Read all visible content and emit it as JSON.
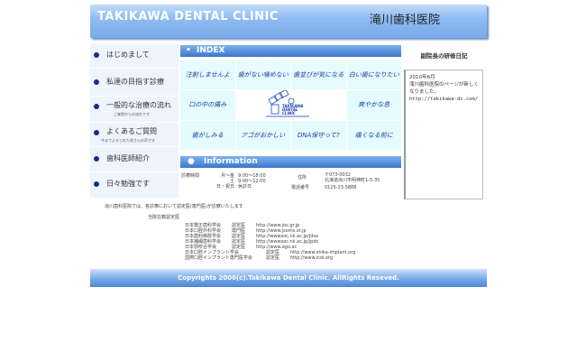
{
  "header": {
    "title_en": "TAKIKAWA DENTAL CLINIC",
    "title_jp": "滝川歯科医院"
  },
  "sidebar": {
    "items": [
      {
        "label": "はじめまして",
        "sub": ""
      },
      {
        "label": "私達の目指す診療",
        "sub": ""
      },
      {
        "label": "一般的な治療の流れ",
        "sub": "ご来院からの流れです"
      },
      {
        "label": "よくあるご質問",
        "sub": "今までよせられた皆さんの声です"
      },
      {
        "label": "歯科医師紹介",
        "sub": ""
      },
      {
        "label": "日々勉強です",
        "sub": ""
      }
    ]
  },
  "index": {
    "title": "INDEX",
    "cells": [
      "注射しませんよ",
      "歯がない噛めない",
      "歯並びが気になる",
      "白い歯になりたい",
      "口の中の痛み",
      "爽やかな息",
      "歯がしみる",
      "アゴがおかしい",
      "DNA保守って?",
      "痛くなる前に"
    ],
    "logo_text": "TAKIKAWA DENTAL CLINIC"
  },
  "information": {
    "title": "Information",
    "hours_label": "診療時間",
    "hours": [
      {
        "day": "月～金",
        "time": "9:00～18:00"
      },
      {
        "day": "土",
        "time": "9:00～12:00"
      },
      {
        "day": "日・祝日",
        "time": "休診日"
      }
    ],
    "address_label": "住所",
    "address": [
      "〒073-0032",
      "北海道滝川市明神町1-5-35"
    ],
    "phone_label": "電話番号",
    "phone": "0125-23-5888"
  },
  "diary": {
    "title": "副院長の研修日記",
    "lines": [
      "2010年6月",
      "滝川歯科医院のページが新しくなりました。",
      "http://takikawa-dc.com/"
    ]
  },
  "certification": {
    "intro": "滝川歯科医院では、各診療において認定医(専門医)が診療いたします",
    "sub": "当院在籍認定医",
    "rows": [
      [
        "日本矯正歯科学会",
        "認定医",
        "http://www.jos.gr.jp"
      ],
      [
        "日本口腔外科学会",
        "専門医",
        "http://www.jsoms.or.jp"
      ],
      [
        "日本歯科麻酔学会",
        "認定医",
        "http://wwwsoc.nii.ac.jp/jdsa"
      ],
      [
        "日本補綴歯科学会",
        "認定医",
        "http://wwwsoc.nii.ac.jp/jpds"
      ],
      [
        "日本顎咬合学会",
        "認定医",
        "http://www.ago.ac"
      ],
      [
        "日本口腔インプラント学会",
        "認定医",
        "http://www.shika-implant.org"
      ],
      [
        "国際口腔インプラント専門医学会",
        "認定医",
        "http://www.icoi.org"
      ]
    ]
  },
  "footer": {
    "text": "Copyrights 2006(c).Takikawa Dental Clinic. AllRights Reseved."
  }
}
